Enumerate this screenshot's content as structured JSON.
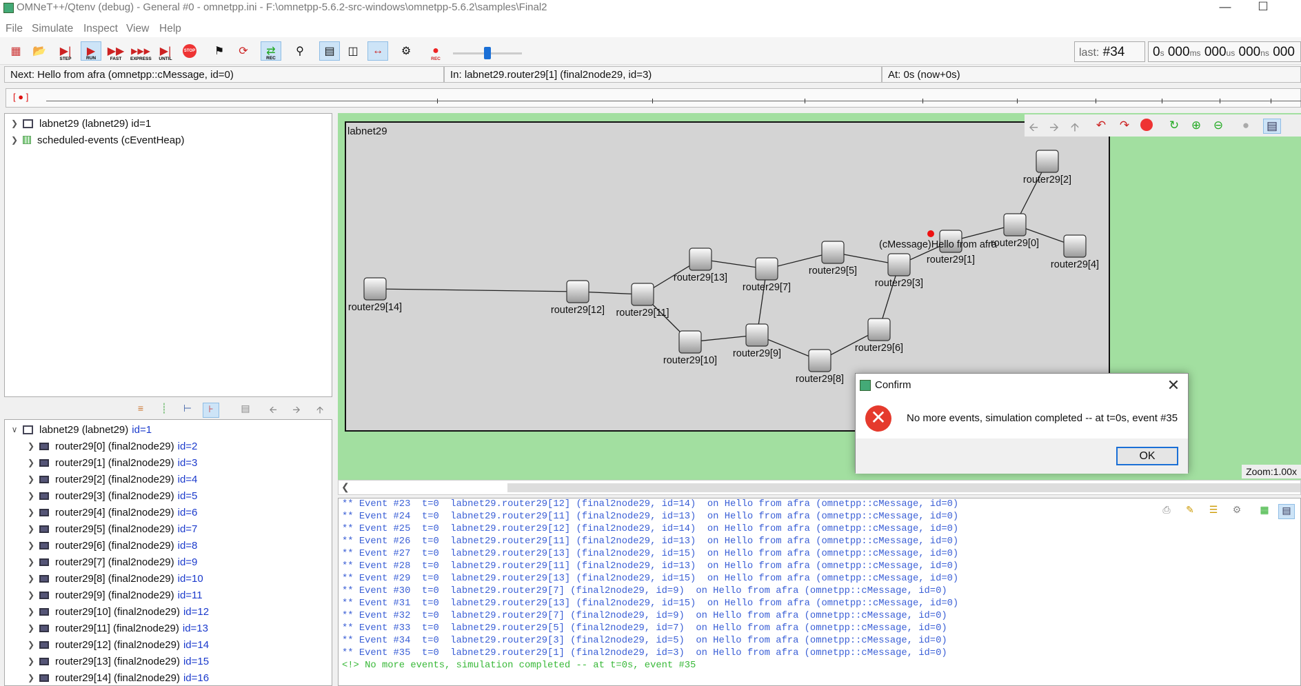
{
  "window": {
    "title": "OMNeT++/Qtenv (debug) - General #0 - omnetpp.ini - F:\\omnetpp-5.6.2-src-windows\\omnetpp-5.6.2\\samples\\Final2"
  },
  "menu": [
    "File",
    "Simulate",
    "Inspect",
    "View",
    "Help"
  ],
  "toolbar": {
    "step": "STEP",
    "run": "RUN",
    "fast": "FAST",
    "express": "EXPRESS",
    "until": "UNTIL",
    "stop": "STOP",
    "rec": "REC",
    "rec2": "REC"
  },
  "counter": {
    "last_label": "last:",
    "last_value": "#34",
    "t1": "0",
    "u1": "s",
    "t2": "000",
    "u2": "ms",
    "t3": "000",
    "u3": "us",
    "t4": "000",
    "u4": "ns",
    "t5": "000"
  },
  "infobar": {
    "next": "Next: Hello from afra (omnetpp::cMessage, id=0)",
    "in": "In: labnet29.router29[1] (final2node29, id=3)",
    "at": "At: 0s (now+0s)"
  },
  "timeline": {
    "marker": "[ ● ]"
  },
  "object_tree": [
    {
      "label": "labnet29 (labnet29) id=1",
      "icon": "network-icon"
    },
    {
      "label": "scheduled-events (cEventHeap)",
      "icon": "heap-icon"
    }
  ],
  "module_tree": {
    "root": {
      "label": "labnet29 (labnet29)",
      "id": "id=1"
    },
    "children": [
      {
        "label": "router29[0] (final2node29)",
        "id": "id=2"
      },
      {
        "label": "router29[1] (final2node29)",
        "id": "id=3"
      },
      {
        "label": "router29[2] (final2node29)",
        "id": "id=4"
      },
      {
        "label": "router29[3] (final2node29)",
        "id": "id=5"
      },
      {
        "label": "router29[4] (final2node29)",
        "id": "id=6"
      },
      {
        "label": "router29[5] (final2node29)",
        "id": "id=7"
      },
      {
        "label": "router29[6] (final2node29)",
        "id": "id=8"
      },
      {
        "label": "router29[7] (final2node29)",
        "id": "id=9"
      },
      {
        "label": "router29[8] (final2node29)",
        "id": "id=10"
      },
      {
        "label": "router29[9] (final2node29)",
        "id": "id=11"
      },
      {
        "label": "router29[10] (final2node29)",
        "id": "id=12"
      },
      {
        "label": "router29[11] (final2node29)",
        "id": "id=13"
      },
      {
        "label": "router29[12] (final2node29)",
        "id": "id=14"
      },
      {
        "label": "router29[13] (final2node29)",
        "id": "id=15"
      },
      {
        "label": "router29[14] (final2node29)",
        "id": "id=16"
      }
    ]
  },
  "network": {
    "name": "labnet29",
    "message_label": "(cMessage)Hello from afra",
    "message_color": "#ee1111",
    "nodes": [
      {
        "name": "router29[0]"
      },
      {
        "name": "router29[1]"
      },
      {
        "name": "router29[2]"
      },
      {
        "name": "router29[3]"
      },
      {
        "name": "router29[4]"
      },
      {
        "name": "router29[5]"
      },
      {
        "name": "router29[6]"
      },
      {
        "name": "router29[7]"
      },
      {
        "name": "router29[8]"
      },
      {
        "name": "router29[9]"
      },
      {
        "name": "router29[10]"
      },
      {
        "name": "router29[11]"
      },
      {
        "name": "router29[12]"
      },
      {
        "name": "router29[13]"
      },
      {
        "name": "router29[14]"
      }
    ],
    "links": [
      [
        14,
        12
      ],
      [
        12,
        11
      ],
      [
        11,
        13
      ],
      [
        11,
        10
      ],
      [
        13,
        7
      ],
      [
        10,
        9
      ],
      [
        7,
        9
      ],
      [
        7,
        5
      ],
      [
        9,
        8
      ],
      [
        8,
        6
      ],
      [
        5,
        3
      ],
      [
        6,
        3
      ],
      [
        3,
        1
      ],
      [
        1,
        0
      ],
      [
        0,
        2
      ],
      [
        0,
        4
      ]
    ],
    "zoom": "Zoom:1.00x",
    "bg_color": "#a2dfa0"
  },
  "log": {
    "lines": [
      "** Event #23  t=0  labnet29.router29[12] (final2node29, id=14)  on Hello from afra (omnetpp::cMessage, id=0)",
      "** Event #24  t=0  labnet29.router29[11] (final2node29, id=13)  on Hello from afra (omnetpp::cMessage, id=0)",
      "** Event #25  t=0  labnet29.router29[12] (final2node29, id=14)  on Hello from afra (omnetpp::cMessage, id=0)",
      "** Event #26  t=0  labnet29.router29[11] (final2node29, id=13)  on Hello from afra (omnetpp::cMessage, id=0)",
      "** Event #27  t=0  labnet29.router29[13] (final2node29, id=15)  on Hello from afra (omnetpp::cMessage, id=0)",
      "** Event #28  t=0  labnet29.router29[11] (final2node29, id=13)  on Hello from afra (omnetpp::cMessage, id=0)",
      "** Event #29  t=0  labnet29.router29[13] (final2node29, id=15)  on Hello from afra (omnetpp::cMessage, id=0)",
      "** Event #30  t=0  labnet29.router29[7] (final2node29, id=9)  on Hello from afra (omnetpp::cMessage, id=0)",
      "** Event #31  t=0  labnet29.router29[13] (final2node29, id=15)  on Hello from afra (omnetpp::cMessage, id=0)",
      "** Event #32  t=0  labnet29.router29[7] (final2node29, id=9)  on Hello from afra (omnetpp::cMessage, id=0)",
      "** Event #33  t=0  labnet29.router29[5] (final2node29, id=7)  on Hello from afra (omnetpp::cMessage, id=0)",
      "** Event #34  t=0  labnet29.router29[3] (final2node29, id=5)  on Hello from afra (omnetpp::cMessage, id=0)",
      "** Event #35  t=0  labnet29.router29[1] (final2node29, id=3)  on Hello from afra (omnetpp::cMessage, id=0)"
    ],
    "final": "<!> No more events, simulation completed -- at t=0s, event #35"
  },
  "dialog": {
    "title": "Confirm",
    "message": "No more events, simulation completed -- at t=0s, event #35",
    "ok": "OK"
  }
}
